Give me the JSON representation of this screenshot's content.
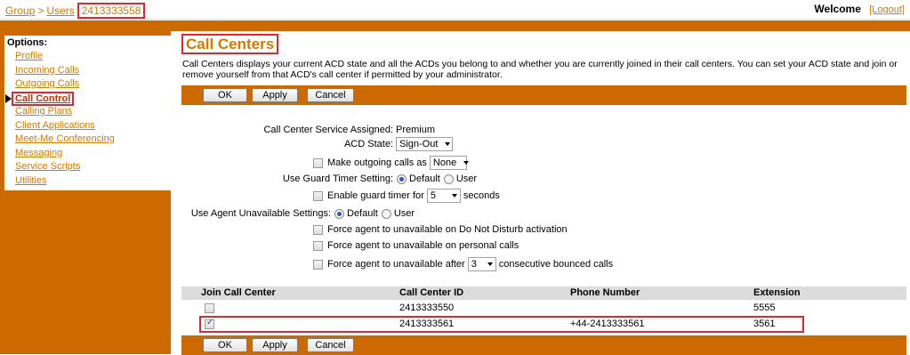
{
  "breadcrumb": {
    "group": "Group",
    "separator": ">",
    "users": "Users",
    "current": "2413333558"
  },
  "header": {
    "welcome": "Welcome",
    "logout": "[Logout]"
  },
  "sidebar": {
    "options_label": "Options:",
    "items": [
      {
        "label": "Profile"
      },
      {
        "label": "Incoming Calls"
      },
      {
        "label": "Outgoing Calls"
      },
      {
        "label": "Call Control",
        "active": true
      },
      {
        "label": "Calling Plans"
      },
      {
        "label": "Client Applications"
      },
      {
        "label": "Meet-Me Conferencing"
      },
      {
        "label": "Messaging"
      },
      {
        "label": "Service Scripts"
      },
      {
        "label": "Utilities"
      }
    ]
  },
  "page": {
    "title": "Call Centers",
    "description": "Call Centers displays your current ACD state and all the ACDs you belong to and whether you are currently joined in their call centers. You can set your ACD state and join or remove yourself from that ACD's call center if permitted by your administrator."
  },
  "buttons": {
    "ok": "OK",
    "apply": "Apply",
    "cancel": "Cancel"
  },
  "form": {
    "service_assigned_label": "Call Center Service Assigned:",
    "service_assigned_value": "Premium",
    "acd_state_label": "ACD State:",
    "acd_state_value": "Sign-Out",
    "outgoing_calls_label": "Make outgoing calls as",
    "outgoing_calls_value": "None",
    "guard_timer_label": "Use Guard Timer Setting:",
    "radio_default": "Default",
    "radio_user": "User",
    "enable_guard_timer_label": "Enable guard timer for",
    "guard_timer_value": "5",
    "seconds_label": "seconds",
    "agent_unavailable_label": "Use Agent Unavailable Settings:",
    "force_dnd_label": "Force agent to unavailable on Do Not Disturb activation",
    "force_personal_label": "Force agent to unavailable on personal calls",
    "force_after_label": "Force agent to unavailable after",
    "bounced_value": "3",
    "bounced_suffix": "consecutive bounced calls"
  },
  "table": {
    "headers": [
      "Join Call Center",
      "Call Center ID",
      "Phone Number",
      "Extension"
    ],
    "rows": [
      {
        "joined": false,
        "id": "2413333550",
        "phone": "",
        "extension": "5555"
      },
      {
        "joined": true,
        "id": "2413333561",
        "phone": "+44-2413333561",
        "extension": "3561"
      }
    ]
  },
  "colors": {
    "accent_orange": "#cc6a00",
    "link_orange": "#d17a00",
    "highlight_red": "#e0262e"
  }
}
